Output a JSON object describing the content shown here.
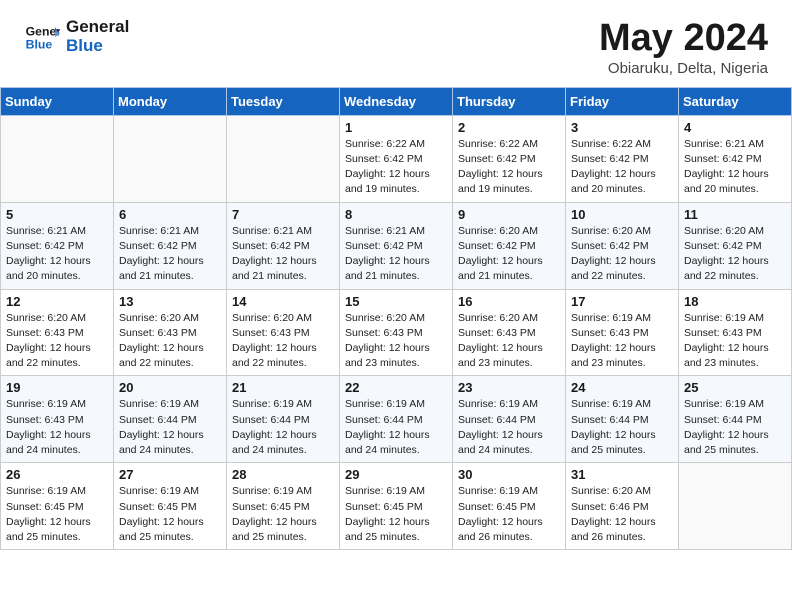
{
  "header": {
    "logo_line1": "General",
    "logo_line2": "Blue",
    "month": "May 2024",
    "location": "Obiaruku, Delta, Nigeria"
  },
  "weekdays": [
    "Sunday",
    "Monday",
    "Tuesday",
    "Wednesday",
    "Thursday",
    "Friday",
    "Saturday"
  ],
  "weeks": [
    [
      {
        "day": "",
        "info": ""
      },
      {
        "day": "",
        "info": ""
      },
      {
        "day": "",
        "info": ""
      },
      {
        "day": "1",
        "info": "Sunrise: 6:22 AM\nSunset: 6:42 PM\nDaylight: 12 hours\nand 19 minutes."
      },
      {
        "day": "2",
        "info": "Sunrise: 6:22 AM\nSunset: 6:42 PM\nDaylight: 12 hours\nand 19 minutes."
      },
      {
        "day": "3",
        "info": "Sunrise: 6:22 AM\nSunset: 6:42 PM\nDaylight: 12 hours\nand 20 minutes."
      },
      {
        "day": "4",
        "info": "Sunrise: 6:21 AM\nSunset: 6:42 PM\nDaylight: 12 hours\nand 20 minutes."
      }
    ],
    [
      {
        "day": "5",
        "info": "Sunrise: 6:21 AM\nSunset: 6:42 PM\nDaylight: 12 hours\nand 20 minutes."
      },
      {
        "day": "6",
        "info": "Sunrise: 6:21 AM\nSunset: 6:42 PM\nDaylight: 12 hours\nand 21 minutes."
      },
      {
        "day": "7",
        "info": "Sunrise: 6:21 AM\nSunset: 6:42 PM\nDaylight: 12 hours\nand 21 minutes."
      },
      {
        "day": "8",
        "info": "Sunrise: 6:21 AM\nSunset: 6:42 PM\nDaylight: 12 hours\nand 21 minutes."
      },
      {
        "day": "9",
        "info": "Sunrise: 6:20 AM\nSunset: 6:42 PM\nDaylight: 12 hours\nand 21 minutes."
      },
      {
        "day": "10",
        "info": "Sunrise: 6:20 AM\nSunset: 6:42 PM\nDaylight: 12 hours\nand 22 minutes."
      },
      {
        "day": "11",
        "info": "Sunrise: 6:20 AM\nSunset: 6:42 PM\nDaylight: 12 hours\nand 22 minutes."
      }
    ],
    [
      {
        "day": "12",
        "info": "Sunrise: 6:20 AM\nSunset: 6:43 PM\nDaylight: 12 hours\nand 22 minutes."
      },
      {
        "day": "13",
        "info": "Sunrise: 6:20 AM\nSunset: 6:43 PM\nDaylight: 12 hours\nand 22 minutes."
      },
      {
        "day": "14",
        "info": "Sunrise: 6:20 AM\nSunset: 6:43 PM\nDaylight: 12 hours\nand 22 minutes."
      },
      {
        "day": "15",
        "info": "Sunrise: 6:20 AM\nSunset: 6:43 PM\nDaylight: 12 hours\nand 23 minutes."
      },
      {
        "day": "16",
        "info": "Sunrise: 6:20 AM\nSunset: 6:43 PM\nDaylight: 12 hours\nand 23 minutes."
      },
      {
        "day": "17",
        "info": "Sunrise: 6:19 AM\nSunset: 6:43 PM\nDaylight: 12 hours\nand 23 minutes."
      },
      {
        "day": "18",
        "info": "Sunrise: 6:19 AM\nSunset: 6:43 PM\nDaylight: 12 hours\nand 23 minutes."
      }
    ],
    [
      {
        "day": "19",
        "info": "Sunrise: 6:19 AM\nSunset: 6:43 PM\nDaylight: 12 hours\nand 24 minutes."
      },
      {
        "day": "20",
        "info": "Sunrise: 6:19 AM\nSunset: 6:44 PM\nDaylight: 12 hours\nand 24 minutes."
      },
      {
        "day": "21",
        "info": "Sunrise: 6:19 AM\nSunset: 6:44 PM\nDaylight: 12 hours\nand 24 minutes."
      },
      {
        "day": "22",
        "info": "Sunrise: 6:19 AM\nSunset: 6:44 PM\nDaylight: 12 hours\nand 24 minutes."
      },
      {
        "day": "23",
        "info": "Sunrise: 6:19 AM\nSunset: 6:44 PM\nDaylight: 12 hours\nand 24 minutes."
      },
      {
        "day": "24",
        "info": "Sunrise: 6:19 AM\nSunset: 6:44 PM\nDaylight: 12 hours\nand 25 minutes."
      },
      {
        "day": "25",
        "info": "Sunrise: 6:19 AM\nSunset: 6:44 PM\nDaylight: 12 hours\nand 25 minutes."
      }
    ],
    [
      {
        "day": "26",
        "info": "Sunrise: 6:19 AM\nSunset: 6:45 PM\nDaylight: 12 hours\nand 25 minutes."
      },
      {
        "day": "27",
        "info": "Sunrise: 6:19 AM\nSunset: 6:45 PM\nDaylight: 12 hours\nand 25 minutes."
      },
      {
        "day": "28",
        "info": "Sunrise: 6:19 AM\nSunset: 6:45 PM\nDaylight: 12 hours\nand 25 minutes."
      },
      {
        "day": "29",
        "info": "Sunrise: 6:19 AM\nSunset: 6:45 PM\nDaylight: 12 hours\nand 25 minutes."
      },
      {
        "day": "30",
        "info": "Sunrise: 6:19 AM\nSunset: 6:45 PM\nDaylight: 12 hours\nand 26 minutes."
      },
      {
        "day": "31",
        "info": "Sunrise: 6:20 AM\nSunset: 6:46 PM\nDaylight: 12 hours\nand 26 minutes."
      },
      {
        "day": "",
        "info": ""
      }
    ]
  ]
}
